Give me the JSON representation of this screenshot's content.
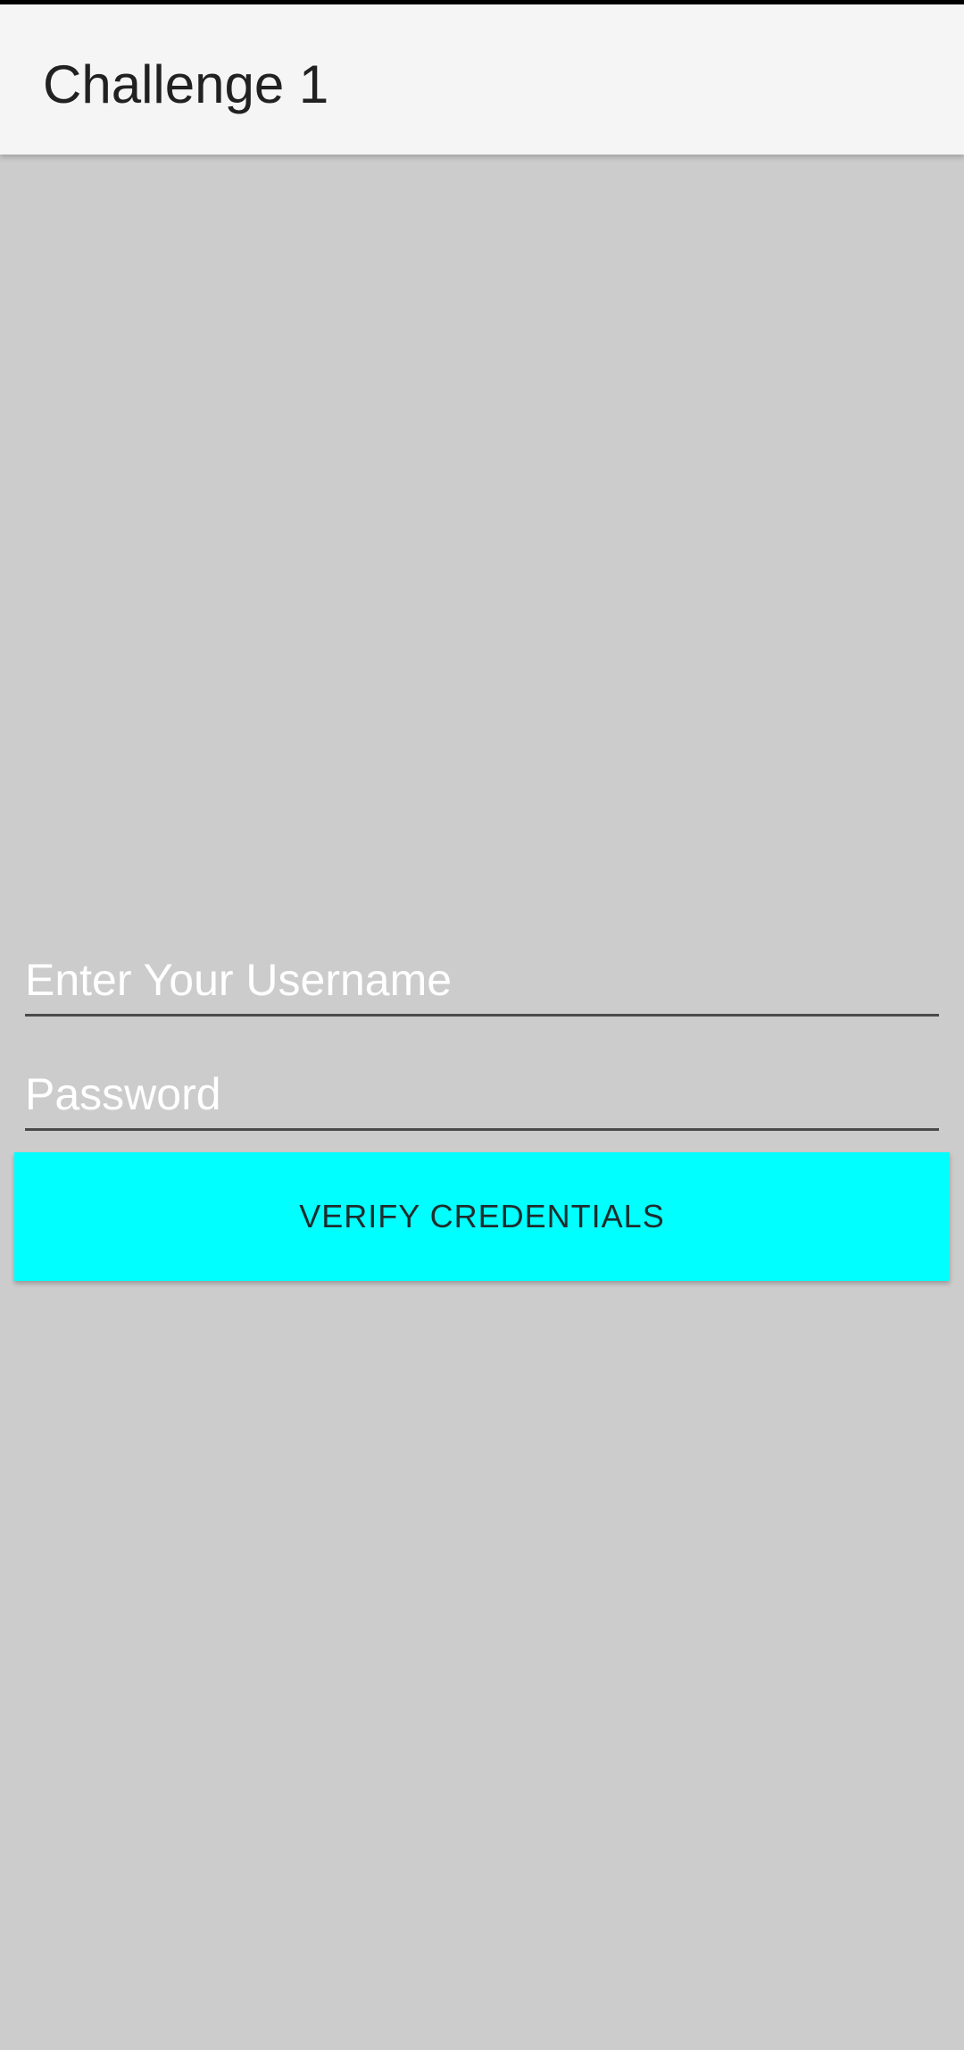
{
  "app_bar": {
    "title": "Challenge 1",
    "background": "#f5f5f5"
  },
  "form": {
    "username": {
      "placeholder": "Enter Your Username",
      "value": ""
    },
    "password": {
      "placeholder": "Password",
      "value": ""
    },
    "verify_button": {
      "label": "VERIFY CREDENTIALS",
      "color": "#00ffff"
    }
  },
  "colors": {
    "screen_background": "#cccccc",
    "underline": "#4a4a4a",
    "placeholder_text": "#ffffff"
  }
}
